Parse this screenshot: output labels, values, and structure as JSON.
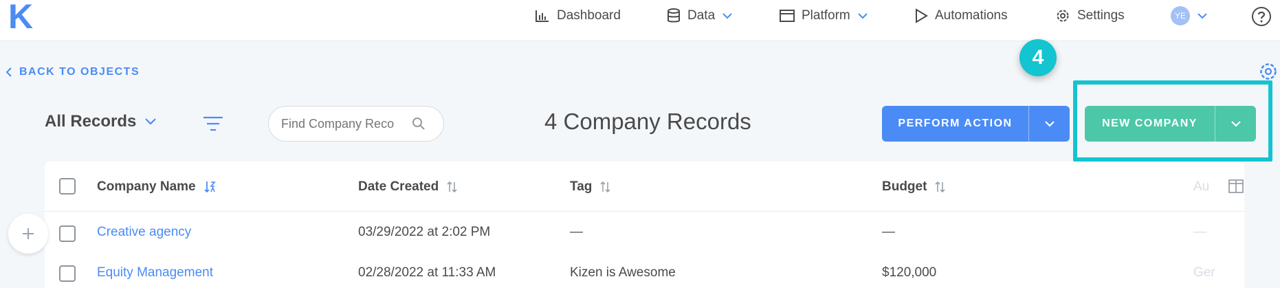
{
  "app": {
    "logo": "K"
  },
  "nav": {
    "dashboard": "Dashboard",
    "data": "Data",
    "platform": "Platform",
    "automations": "Automations",
    "settings": "Settings",
    "avatar": "YE"
  },
  "back_link": "BACK TO OBJECTS",
  "toolbar": {
    "records_select": "All Records",
    "search_placeholder": "Find Company Reco",
    "record_count": "4 Company Records",
    "perform_action": "PERFORM ACTION",
    "new_company": "NEW COMPANY"
  },
  "tutorial": {
    "step": "4"
  },
  "table": {
    "headers": [
      "Company Name",
      "Date Created",
      "Tag",
      "Budget",
      "Au"
    ],
    "rows": [
      [
        "Creative agency",
        "03/29/2022 at 2:02 PM",
        "—",
        "—",
        "—"
      ],
      [
        "Equity Management",
        "02/28/2022 at 11:33 AM",
        "Kizen is Awesome",
        "$120,000",
        "Ger"
      ]
    ]
  },
  "colors": {
    "accent_blue": "#4a8bf5",
    "accent_green": "#4cc7a8",
    "highlight_teal": "#14c4d0"
  }
}
